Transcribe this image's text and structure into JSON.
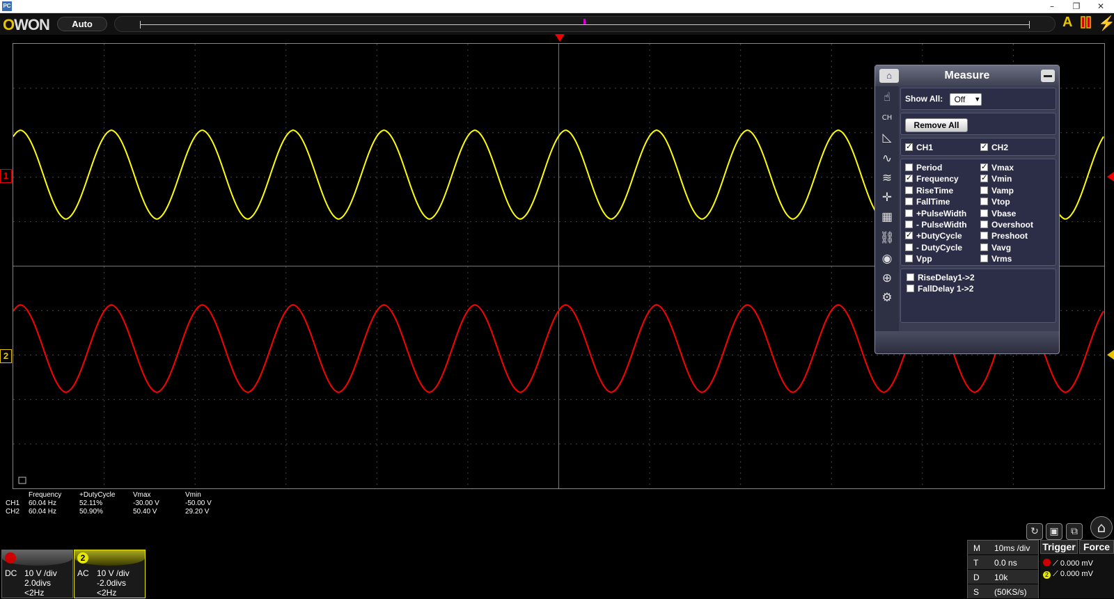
{
  "window": {
    "app_icon": "PC",
    "controls": [
      "–",
      "❐",
      "✕"
    ]
  },
  "toolbar": {
    "logo": "OWON",
    "mode_button": "Auto",
    "right_icons": [
      "A-icon",
      "run-stop-icon",
      "lightning-icon"
    ]
  },
  "channels": [
    {
      "id": "1",
      "color": "#ffff00"
    },
    {
      "id": "2",
      "color": "#ff0000"
    }
  ],
  "measure_panel": {
    "title": "Measure",
    "show_all_label": "Show All:",
    "show_all_value": "Off",
    "remove_all": "Remove All",
    "ch1_label": "CH1",
    "ch2_label": "CH2",
    "ch1_checked": true,
    "ch2_checked": true,
    "left_items": [
      {
        "label": "Period",
        "checked": false
      },
      {
        "label": "Frequency",
        "checked": true
      },
      {
        "label": "RiseTime",
        "checked": false
      },
      {
        "label": "FallTime",
        "checked": false
      },
      {
        "label": "+PulseWidth",
        "checked": false
      },
      {
        "label": "- PulseWidth",
        "checked": false
      },
      {
        "label": "+DutyCycle",
        "checked": true
      },
      {
        "label": "- DutyCycle",
        "checked": false
      },
      {
        "label": "Vpp",
        "checked": false
      }
    ],
    "right_items": [
      {
        "label": "Vmax",
        "checked": true
      },
      {
        "label": "Vmin",
        "checked": true
      },
      {
        "label": "Vamp",
        "checked": false
      },
      {
        "label": "Vtop",
        "checked": false
      },
      {
        "label": "Vbase",
        "checked": false
      },
      {
        "label": "Overshoot",
        "checked": false
      },
      {
        "label": "Preshoot",
        "checked": false
      },
      {
        "label": "Vavg",
        "checked": false
      },
      {
        "label": "Vrms",
        "checked": false
      }
    ],
    "delay_items": [
      {
        "label": "RiseDelay1->2",
        "checked": false
      },
      {
        "label": "FallDelay 1->2",
        "checked": false
      }
    ]
  },
  "measurements": {
    "headers": [
      "Frequency",
      "+DutyCycle",
      "Vmax",
      "Vmin"
    ],
    "rows": [
      {
        "ch": "CH1",
        "values": [
          "60.04 Hz",
          "52.11%",
          "-30.00 V",
          "-50.00 V"
        ]
      },
      {
        "ch": "CH2",
        "values": [
          "60.04 Hz",
          "50.90%",
          "50.40 V",
          "29.20 V"
        ]
      }
    ]
  },
  "ch_boxes": [
    {
      "id": "1",
      "coupling": "DC",
      "scale": "10 V /div",
      "offset": "2.0divs",
      "bw": "<2Hz"
    },
    {
      "id": "2",
      "coupling": "AC",
      "scale": "10 V /div",
      "offset": "-2.0divs",
      "bw": "<2Hz"
    }
  ],
  "timebase": [
    {
      "k": "M",
      "v": "10ms /div"
    },
    {
      "k": "T",
      "v": "0.0 ns"
    },
    {
      "k": "D",
      "v": "10k"
    },
    {
      "k": "S",
      "v": "(50KS/s)"
    }
  ],
  "trigger": {
    "trigger_label": "Trigger",
    "force_label": "Force",
    "level1": "0.000 mV",
    "level2": "0.000 mV"
  }
}
